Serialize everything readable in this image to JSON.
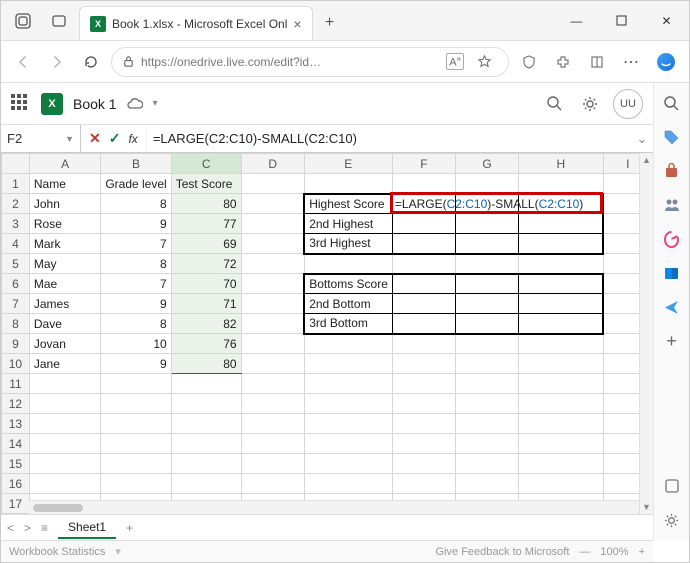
{
  "window": {
    "tab_title": "Book 1.xlsx - Microsoft Excel Onl",
    "min": "—",
    "max": "▢",
    "close": "✕"
  },
  "browser": {
    "url": "https://onedrive.live.com/edit?id…"
  },
  "excel_header": {
    "doc_name": "Book 1",
    "user_initials": "UU"
  },
  "formula_bar": {
    "cell_ref": "F2",
    "formula_plain": "=LARGE(C2:C10)-SMALL(C2:C10)",
    "formula_prefix1": "=LARGE(",
    "formula_ref1": "C2:C10",
    "formula_mid": ")-SMALL(",
    "formula_ref2": "C2:C10",
    "formula_suffix": ")"
  },
  "columns": [
    "A",
    "B",
    "C",
    "D",
    "E",
    "F",
    "G",
    "H",
    "I"
  ],
  "row_headers": [
    "1",
    "2",
    "3",
    "4",
    "5",
    "6",
    "7",
    "8",
    "9",
    "10",
    "11",
    "12",
    "13",
    "14",
    "15",
    "16",
    "17"
  ],
  "sheet": {
    "headers": {
      "A": "Name",
      "B": "Grade level",
      "C": "Test Score"
    },
    "rows": [
      {
        "name": "John",
        "grade": "8",
        "score": "80"
      },
      {
        "name": "Rose",
        "grade": "9",
        "score": "77"
      },
      {
        "name": "Mark",
        "grade": "7",
        "score": "69"
      },
      {
        "name": "May",
        "grade": "8",
        "score": "72"
      },
      {
        "name": "Mae",
        "grade": "7",
        "score": "70"
      },
      {
        "name": "James",
        "grade": "9",
        "score": "71"
      },
      {
        "name": "Dave",
        "grade": "8",
        "score": "82"
      },
      {
        "name": "Jovan",
        "grade": "10",
        "score": "76"
      },
      {
        "name": "Jane",
        "grade": "9",
        "score": "80"
      }
    ],
    "labels": {
      "E2": "Highest Score",
      "E3": "2nd Highest",
      "E4": "3rd Highest",
      "E6": "Bottoms Score",
      "E7": "2nd Bottom",
      "E8": "3rd Bottom"
    },
    "active_formula_display": "=LARGE(C2:C10)-SMALL(C2:C10)"
  },
  "sheet_tabs": {
    "active": "Sheet1"
  },
  "status": {
    "workbook_stats": "Workbook Statistics",
    "feedback": "Give Feedback to Microsoft",
    "zoom": "100%"
  }
}
